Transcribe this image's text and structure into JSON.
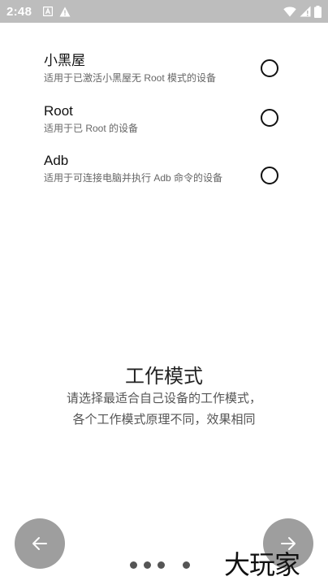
{
  "status_bar": {
    "time": "2:48"
  },
  "options": [
    {
      "title": "小黑屋",
      "description": "适用于已激活小黑屋无 Root 模式的设备",
      "selected": false
    },
    {
      "title": "Root",
      "description": "适用于已 Root 的设备",
      "selected": false
    },
    {
      "title": "Adb",
      "description": "适用于可连接电脑并执行 Adb 命令的设备",
      "selected": false
    }
  ],
  "heading": "工作模式",
  "subtitle_line1": "请选择最适合自己设备的工作模式，",
  "subtitle_line2": "各个工作模式原理不同，效果相同",
  "navigation": {
    "back_icon": "arrow-left-icon",
    "next_icon": "arrow-right-icon",
    "page_indicator_dots": 4
  },
  "watermark": "大玩家",
  "colors": {
    "status_bar": "#bdbdbd",
    "nav_button": "#9e9e9e",
    "text_primary": "#111111",
    "text_secondary": "#666666"
  }
}
